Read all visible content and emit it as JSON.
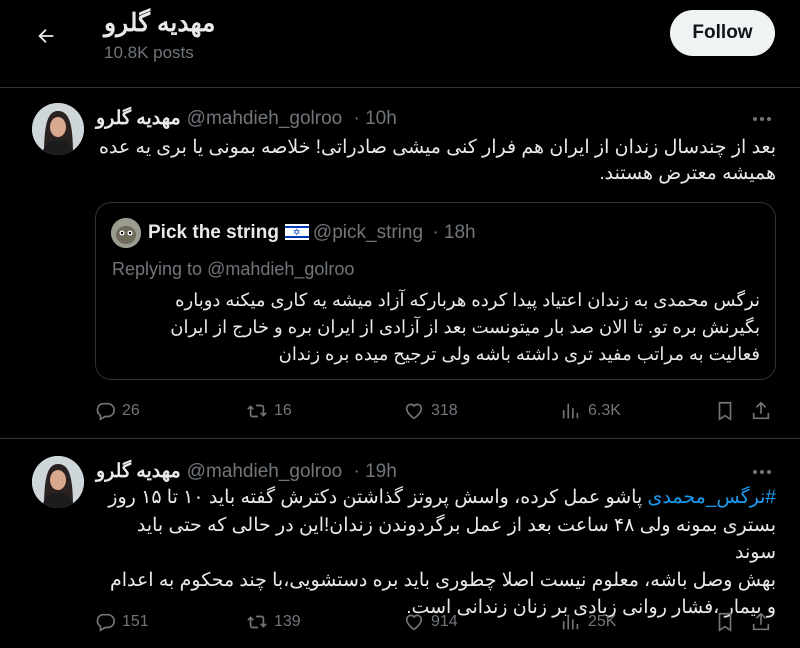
{
  "header": {
    "title": "مهدیه گلرو",
    "post_count": "10.8K posts",
    "follow_label": "Follow"
  },
  "tweets": [
    {
      "name": "مهدیه گلرو",
      "handle": "@mahdieh_golroo",
      "time": "· 10h",
      "text_line1": "بعد از چندسال زندان از ایران هم فرار کنی میشی صادراتی! خلاصه بمونی یا بری یه عده",
      "text_line2": "همیشه معترض هستند.",
      "quote": {
        "name": "Pick the string",
        "flag": "israel-flag",
        "handle": "@pick_string",
        "time": "· 18h",
        "replying_prefix": "Replying to",
        "replying_handle": "@mahdieh_golroo",
        "text_line1": "نرگس محمدی به زندان اعتیاد پیدا کرده هربارکه آزاد میشه یه کاری میکنه دوباره",
        "text_line2": "بگیرنش بره تو. تا الان صد بار میتونست بعد از آزادی از ایران بره و خارج از ایران",
        "text_line3": "فعالیت به مراتب مفید تری داشته باشه ولی ترجیح میده بره زندان"
      },
      "stats": {
        "replies": "26",
        "reposts": "16",
        "likes": "318",
        "views": "6.3K"
      }
    },
    {
      "name": "مهدیه گلرو",
      "handle": "@mahdieh_golroo",
      "time": "· 19h",
      "hashtag": "#نرگس_محمدی",
      "text_line1_rest": " پاشو عمل کرده، واسش پروتز گذاشتن دکترش گفته  باید ۱۰ تا ۱۵ روز",
      "text_line2": "بستری بمونه ولی ۴۸ ساعت بعد از عمل برگردوندن زندان!این در حالی که حتی باید سوند",
      "text_line3": "بهش وصل باشه، معلوم نیست اصلا چطوری باید بره دستشویی،با چند محکوم به اعدام",
      "text_line4": "و بیمار ،فشار روانی زیادی بر زنان زندانی است.",
      "stats": {
        "replies": "151",
        "reposts": "139",
        "likes": "914",
        "views": "25K"
      }
    }
  ],
  "icons": [
    "back-arrow-icon",
    "more-icon",
    "reply-icon",
    "repost-icon",
    "like-icon",
    "views-icon",
    "bookmark-icon",
    "share-icon"
  ],
  "colors": {
    "background": "#000000",
    "text": "#e7e9ea",
    "muted": "#71767b",
    "link": "#1d9bf0",
    "border": "#2f3336"
  }
}
